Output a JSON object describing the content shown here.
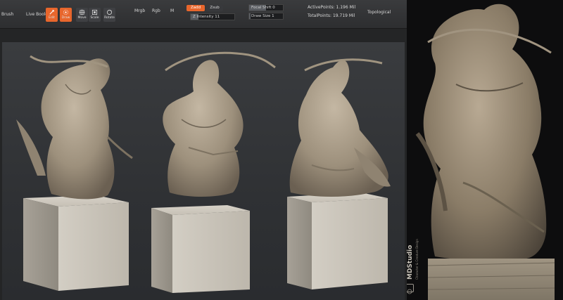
{
  "toolbar": {
    "brush_label": "Brush",
    "live_boolean": "Live Boolean",
    "edit_label": "Edit",
    "draw_label": "Draw",
    "move_label": "Move",
    "scale_label": "Scale",
    "rotate_label": "Rotate",
    "mrgb": "Mrgb",
    "rgb": "Rgb",
    "m": "M",
    "zadd": "Zadd",
    "zsub": "Zsub",
    "z_intensity": "Z Intensity 11",
    "focal_shift": "Focal Shift 0",
    "draw_size": "Draw Size 1",
    "active_points": "ActivePoints: 1.196 Mil",
    "total_points": "TotalPoints: 19.719 Mil",
    "topological": "Topological"
  },
  "colors": {
    "accent": "#e8662c",
    "sculpt": "#a89a86",
    "pedestal": "#cfcac0"
  },
  "viewport": {
    "figures": [
      "front-left-view",
      "front-view",
      "side-view"
    ]
  },
  "photo": {
    "watermark_brand": "MDStudio",
    "watermark_tagline": "Character & Creature Design"
  }
}
